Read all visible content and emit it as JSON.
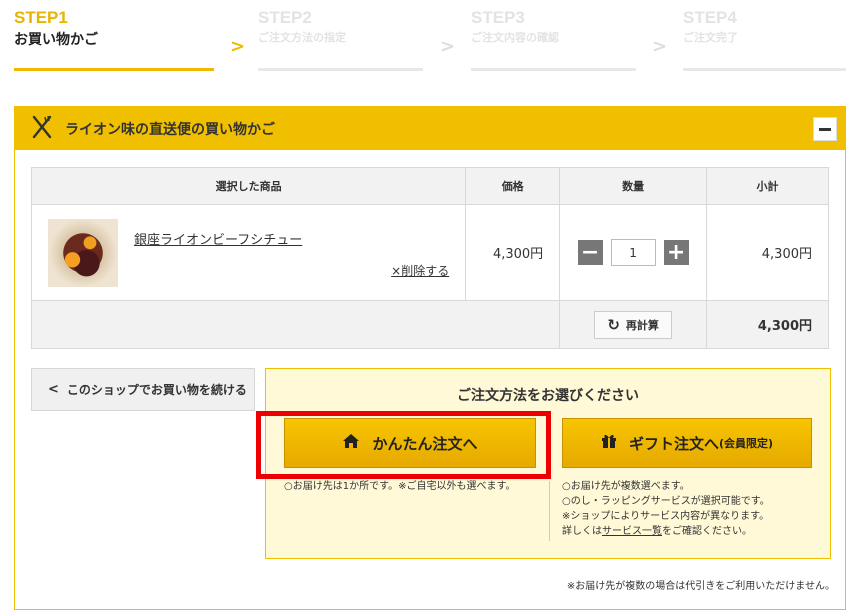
{
  "steps": [
    {
      "num": "STEP1",
      "label": "お買い物かご"
    },
    {
      "num": "STEP2",
      "label": "ご注文方法の指定"
    },
    {
      "num": "STEP3",
      "label": "ご注文内容の確認"
    },
    {
      "num": "STEP4",
      "label": "ご注文完了"
    }
  ],
  "cart": {
    "title": "ライオン味の直送便の買い物かご",
    "columns": {
      "item": "選択した商品",
      "price": "価格",
      "qty": "数量",
      "subtotal": "小計"
    },
    "items": [
      {
        "name": "銀座ライオンビーフシチュー",
        "delete_label": "×削除する",
        "price": "4,300円",
        "qty": "1",
        "subtotal": "4,300円"
      }
    ],
    "recalc_label": "再計算",
    "total": "4,300円"
  },
  "continue_label": "このショップでお買い物を続ける",
  "order": {
    "title": "ご注文方法をお選びください",
    "easy_label": "かんたん注文へ",
    "gift_label": "ギフト注文へ",
    "gift_sub": "(会員限定)",
    "easy_note": "○お届け先は1か所です。※ご自宅以外も選べます。",
    "gift_note_1": "○お届け先が複数選べます。",
    "gift_note_2": "○のし・ラッピングサービスが選択可能です。",
    "gift_note_3": "※ショップによりサービス内容が異なります。",
    "gift_note_4_pre": "詳しくは",
    "gift_note_4_link": "サービス一覧",
    "gift_note_4_post": "をご確認ください。"
  },
  "footer_note": "※お届け先が複数の場合は代引きをご利用いただけません。",
  "colors": {
    "accent": "#f0c000",
    "highlight": "#ee0000"
  },
  "icons": [
    "chevron-right-icon",
    "utensils-icon",
    "minus-icon",
    "plus-icon",
    "refresh-icon",
    "chevron-left-icon",
    "home-icon",
    "gift-icon"
  ]
}
